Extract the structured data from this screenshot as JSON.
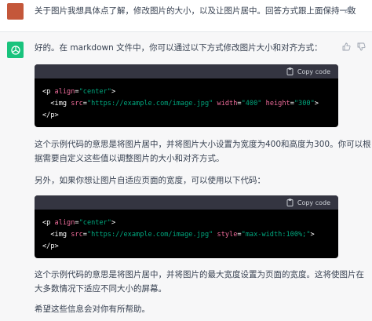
{
  "user_message": {
    "text": "关于图片我想具体点了解，修改图片的大小，以及让图片居中。回答方式跟上面保持一致"
  },
  "assistant": {
    "intro": "好的。在 markdown 文件中，你可以通过以下方式修改图片大小和对齐方式：",
    "code1": {
      "copy_label": "Copy code",
      "line1": {
        "open": "<p ",
        "attr": "align",
        "eq": "=",
        "val": "\"center\"",
        "close": ">"
      },
      "line2": {
        "open": "  <img ",
        "attr1": "src",
        "val1": "\"https://example.com/image.jpg\"",
        "attr2": "width",
        "val2": "\"400\"",
        "attr3": "height",
        "val3": "\"300\"",
        "close": ">"
      },
      "line3": "</p>"
    },
    "para1": "这个示例代码的意思是将图片居中，并将图片大小设置为宽度为400和高度为300。你可以根据需要自定义这些值以调整图片的大小和对齐方式。",
    "para1_line1": "这个示例代码的意思是将图片居中，并将图片大小设置为宽度为400和高度为300。你可以根",
    "para1_line2": "据需要自定义这些值以调整图片的大小和对齐方式。",
    "para2": "另外，如果你想让图片自适应页面的宽度，可以使用以下代码：",
    "code2": {
      "copy_label": "Copy code",
      "line1": {
        "open": "<p ",
        "attr": "align",
        "eq": "=",
        "val": "\"center\"",
        "close": ">"
      },
      "line2": {
        "open": "  <img ",
        "attr1": "src",
        "val1": "\"https://example.com/image.jpg\"",
        "attr2": "style",
        "val2": "\"max-width:100%;\"",
        "close": ">"
      },
      "line3": "</p>"
    },
    "para3_line1": "这个示例代码的意思是将图片居中，并将图片的最大宽度设置为页面的宽度。这将使图片在",
    "para3_line2": "大多数情况下适应不同大小的屏幕。",
    "para4": "希望这些信息会对你有所帮助。"
  },
  "icons": {
    "edit": "edit-icon",
    "bot": "chatgpt-logo-icon",
    "thumbs_up": "thumbs-up-icon",
    "thumbs_down": "thumbs-down-icon",
    "copy": "clipboard-icon"
  },
  "colors": {
    "user_avatar": "#c4573a",
    "bot_avatar": "#19c37d",
    "assistant_bg": "#f7f7f8",
    "code_bg": "#000000",
    "code_header_bg": "#343541",
    "code_attr": "#ef6c9b",
    "code_string": "#00a67d"
  }
}
